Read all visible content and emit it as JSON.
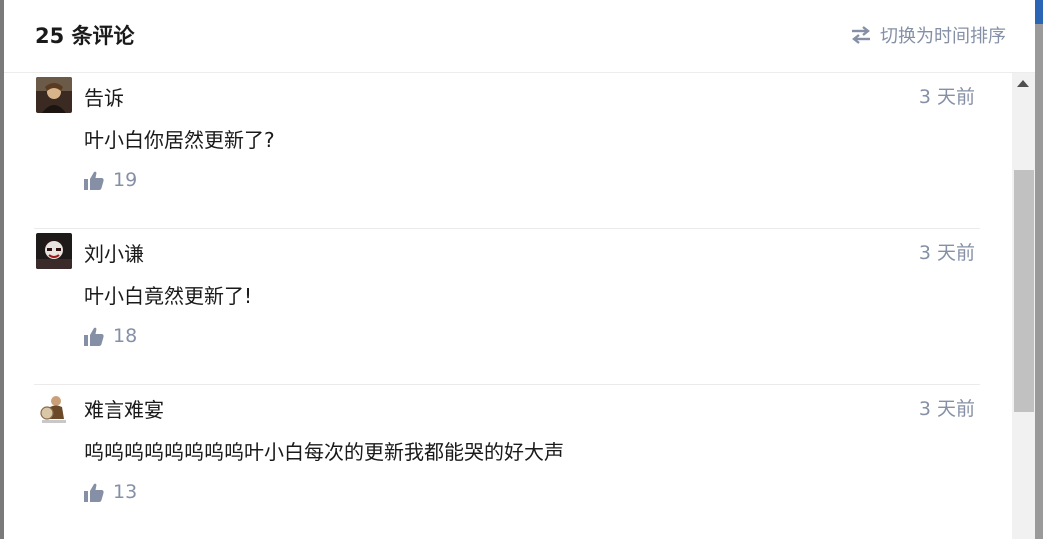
{
  "header": {
    "title": "25 条评论",
    "sort_label": "切换为时间排序",
    "sort_icon": "swap-arrows-icon"
  },
  "comments": [
    {
      "author": "告诉",
      "time": "3 天前",
      "content": "叶小白你居然更新了?",
      "likes": "19"
    },
    {
      "author": "刘小谦",
      "time": "3 天前",
      "content": "叶小白竟然更新了!",
      "likes": "18"
    },
    {
      "author": "难言难宴",
      "time": "3 天前",
      "content": "呜呜呜呜呜呜呜呜叶小白每次的更新我都能哭的好大声",
      "likes": "13"
    }
  ],
  "colors": {
    "muted": "#8590a6",
    "text": "#1a1a1a",
    "divider": "#ebebeb"
  }
}
